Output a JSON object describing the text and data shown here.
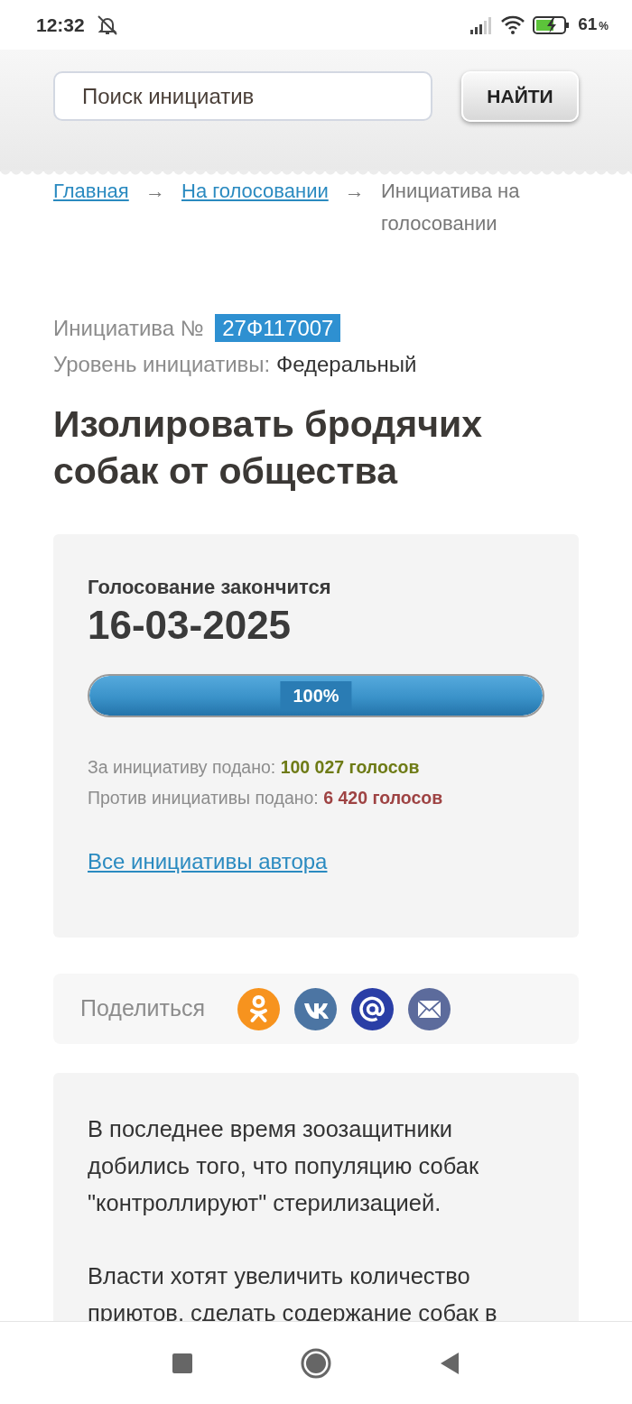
{
  "status_bar": {
    "time": "12:32",
    "battery_percent": "61",
    "percent_sign": "%"
  },
  "search": {
    "placeholder": "Поиск инициатив",
    "button": "НАЙТИ"
  },
  "breadcrumbs": [
    {
      "kind": "link",
      "label": "Главная"
    },
    {
      "kind": "separator",
      "label": "→"
    },
    {
      "kind": "link",
      "label": "На голосовании"
    },
    {
      "kind": "separator",
      "label": "→"
    },
    {
      "kind": "current",
      "label": "Инициатива на голосовании"
    }
  ],
  "initiative": {
    "number_label": "Инициатива №",
    "number": "27Ф117007",
    "level_label": "Уровень инициативы:",
    "level_value": "Федеральный",
    "title": "Изолировать бродячих собак от общества"
  },
  "voting": {
    "ends_label": "Голосование закончится",
    "ends_date": "16-03-2025",
    "progress": {
      "level": 1,
      "label": "100%"
    },
    "votes": [
      {
        "label": "За инициативу подано:",
        "value": "100 027 голосов",
        "color": "#6e7b16"
      },
      {
        "label": "Против инициативы подано:",
        "value": "6 420 голосов",
        "color": "#9e4343"
      }
    ],
    "author_link": "Все инициативы автора"
  },
  "share": {
    "label": "Поделиться",
    "buttons": [
      {
        "kind": "ok"
      },
      {
        "kind": "vk"
      },
      {
        "kind": "mail"
      },
      {
        "kind": "email"
      }
    ]
  },
  "description": {
    "paragraphs": [
      "В последнее время зоозащитники добились того, что популяцию собак \"контроллируют\" стерилизацией.",
      "Власти хотят увеличить количество приютов, сделать содержание собак в"
    ]
  }
}
